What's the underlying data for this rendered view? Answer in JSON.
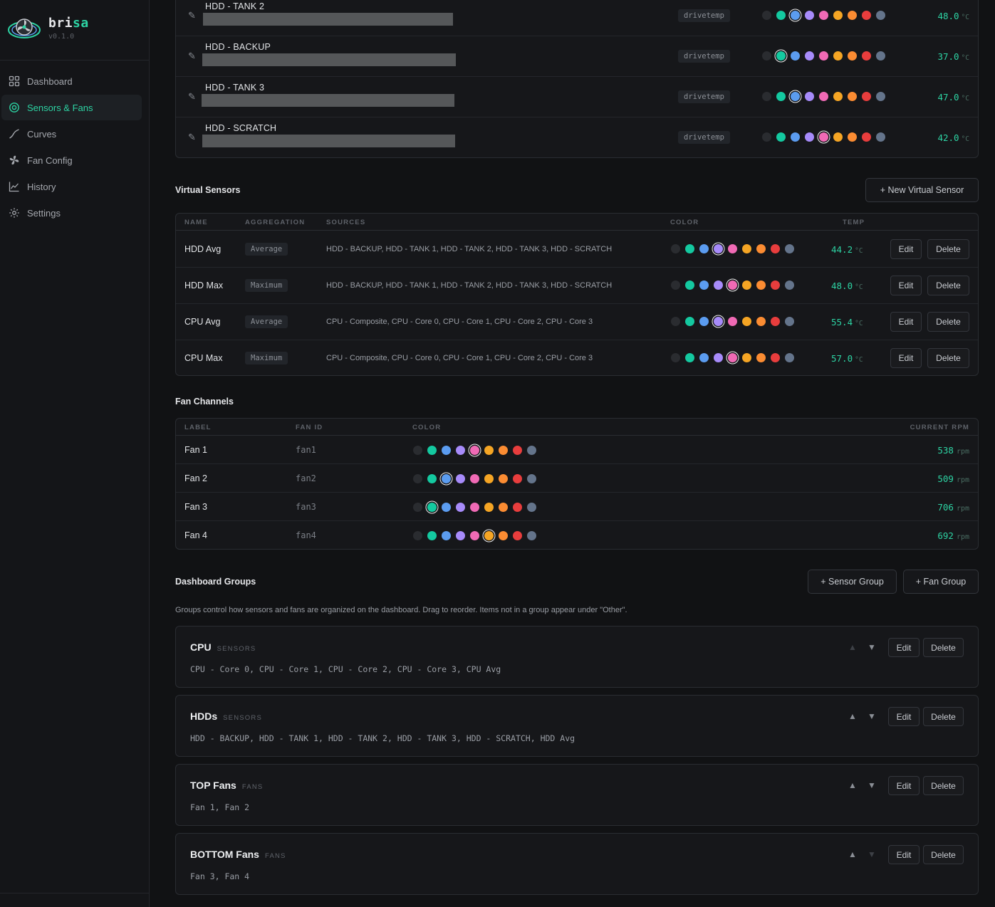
{
  "app": {
    "name_prefix": "bri",
    "name_accent": "sa",
    "version": "v0.1.0"
  },
  "colors": {
    "accent": "#2dd4a4",
    "bg": "#111214",
    "panel": "#16171a"
  },
  "palette": [
    "#2a2c30",
    "#14c9a0",
    "#5b9cf0",
    "#a78bfa",
    "#f06ab5",
    "#f5a524",
    "#fb8c32",
    "#e83d3d",
    "#64748b"
  ],
  "nav": [
    {
      "label": "Dashboard",
      "icon": "grid-icon",
      "active": false
    },
    {
      "label": "Sensors & Fans",
      "icon": "target-icon",
      "active": true
    },
    {
      "label": "Curves",
      "icon": "curve-icon",
      "active": false
    },
    {
      "label": "Fan Config",
      "icon": "fan-icon",
      "active": false
    },
    {
      "label": "History",
      "icon": "history-chart-icon",
      "active": false
    },
    {
      "label": "Settings",
      "icon": "gear-icon",
      "active": false
    }
  ],
  "sensors": [
    {
      "label": "HDD - TANK 2",
      "driver": "drivetemp",
      "selected_color": 2,
      "temp": "48.0",
      "unit": "°C"
    },
    {
      "label": "HDD - BACKUP",
      "driver": "drivetemp",
      "selected_color": 1,
      "temp": "37.0",
      "unit": "°C"
    },
    {
      "label": "HDD - TANK 3",
      "driver": "drivetemp",
      "selected_color": 2,
      "temp": "47.0",
      "unit": "°C"
    },
    {
      "label": "HDD - SCRATCH",
      "driver": "drivetemp",
      "selected_color": 4,
      "temp": "42.0",
      "unit": "°C"
    }
  ],
  "virtual": {
    "title": "Virtual Sensors",
    "new_button": "+ New Virtual Sensor",
    "headers": {
      "name": "NAME",
      "aggregation": "AGGREGATION",
      "sources": "SOURCES",
      "color": "COLOR",
      "temp": "TEMP"
    },
    "edit_label": "Edit",
    "delete_label": "Delete",
    "rows": [
      {
        "name": "HDD Avg",
        "aggregation": "Average",
        "sources": "HDD - BACKUP, HDD - TANK 1, HDD - TANK 2, HDD - TANK 3, HDD - SCRATCH",
        "selected_color": 3,
        "temp": "44.2",
        "unit": "°C"
      },
      {
        "name": "HDD Max",
        "aggregation": "Maximum",
        "sources": "HDD - BACKUP, HDD - TANK 1, HDD - TANK 2, HDD - TANK 3, HDD - SCRATCH",
        "selected_color": 4,
        "temp": "48.0",
        "unit": "°C"
      },
      {
        "name": "CPU Avg",
        "aggregation": "Average",
        "sources": "CPU - Composite, CPU - Core 0, CPU - Core 1, CPU - Core 2, CPU - Core 3",
        "selected_color": 3,
        "temp": "55.4",
        "unit": "°C"
      },
      {
        "name": "CPU Max",
        "aggregation": "Maximum",
        "sources": "CPU - Composite, CPU - Core 0, CPU - Core 1, CPU - Core 2, CPU - Core 3",
        "selected_color": 4,
        "temp": "57.0",
        "unit": "°C"
      }
    ]
  },
  "fans": {
    "title": "Fan Channels",
    "headers": {
      "label": "LABEL",
      "fan_id": "FAN ID",
      "color": "COLOR",
      "rpm": "CURRENT RPM"
    },
    "rows": [
      {
        "label": "Fan 1",
        "fan_id": "fan1",
        "selected_color": 4,
        "rpm": "538",
        "unit": "rpm"
      },
      {
        "label": "Fan 2",
        "fan_id": "fan2",
        "selected_color": 2,
        "rpm": "509",
        "unit": "rpm"
      },
      {
        "label": "Fan 3",
        "fan_id": "fan3",
        "selected_color": 1,
        "rpm": "706",
        "unit": "rpm"
      },
      {
        "label": "Fan 4",
        "fan_id": "fan4",
        "selected_color": 5,
        "rpm": "692",
        "unit": "rpm"
      }
    ]
  },
  "groups": {
    "title": "Dashboard Groups",
    "sensor_group_button": "+ Sensor Group",
    "fan_group_button": "+ Fan Group",
    "description": "Groups control how sensors and fans are organized on the dashboard. Drag to reorder. Items not in a group appear under \"Other\".",
    "edit_label": "Edit",
    "delete_label": "Delete",
    "up_arrow": "▲",
    "down_arrow": "▼",
    "items": [
      {
        "name": "CPU",
        "kind": "SENSORS",
        "members": "CPU - Core 0, CPU - Core 1, CPU - Core 2, CPU - Core 3, CPU Avg",
        "up_enabled": false,
        "down_enabled": true
      },
      {
        "name": "HDDs",
        "kind": "SENSORS",
        "members": "HDD - BACKUP, HDD - TANK 1, HDD - TANK 2, HDD - TANK 3, HDD - SCRATCH, HDD Avg",
        "up_enabled": true,
        "down_enabled": true
      },
      {
        "name": "TOP Fans",
        "kind": "FANS",
        "members": "Fan 1, Fan 2",
        "up_enabled": true,
        "down_enabled": true
      },
      {
        "name": "BOTTOM Fans",
        "kind": "FANS",
        "members": "Fan 3, Fan 4",
        "up_enabled": true,
        "down_enabled": false
      }
    ]
  }
}
